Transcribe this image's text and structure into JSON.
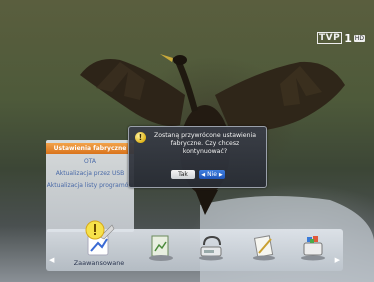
{
  "channel": {
    "logo_text": "TVP",
    "logo_number": "1",
    "logo_badge": "HD"
  },
  "settings_menu": {
    "items": [
      {
        "label": "Ustawienia fabryczne",
        "active": true
      },
      {
        "label": "OTA",
        "active": false
      },
      {
        "label": "Aktualizacja przez USB",
        "active": false
      },
      {
        "label": "Aktualizacja listy programów",
        "active": false
      }
    ]
  },
  "dialog": {
    "icon": "!",
    "message": "Zostaną przywrócone ustawienia fabryczne. Czy chcesz kontynuować?",
    "yes_label": "Tak",
    "no_label": "Nie",
    "selected": "Nie"
  },
  "bottom_bar": {
    "selected_label": "Zaawansowane",
    "icons": [
      "advanced-settings-icon",
      "picture-settings-icon",
      "network-settings-icon",
      "tools-icon",
      "system-icon"
    ]
  },
  "colors": {
    "menu_active": "#e88a2e",
    "menu_text": "#4a6aa8",
    "button_selected": "#2a66cc"
  }
}
